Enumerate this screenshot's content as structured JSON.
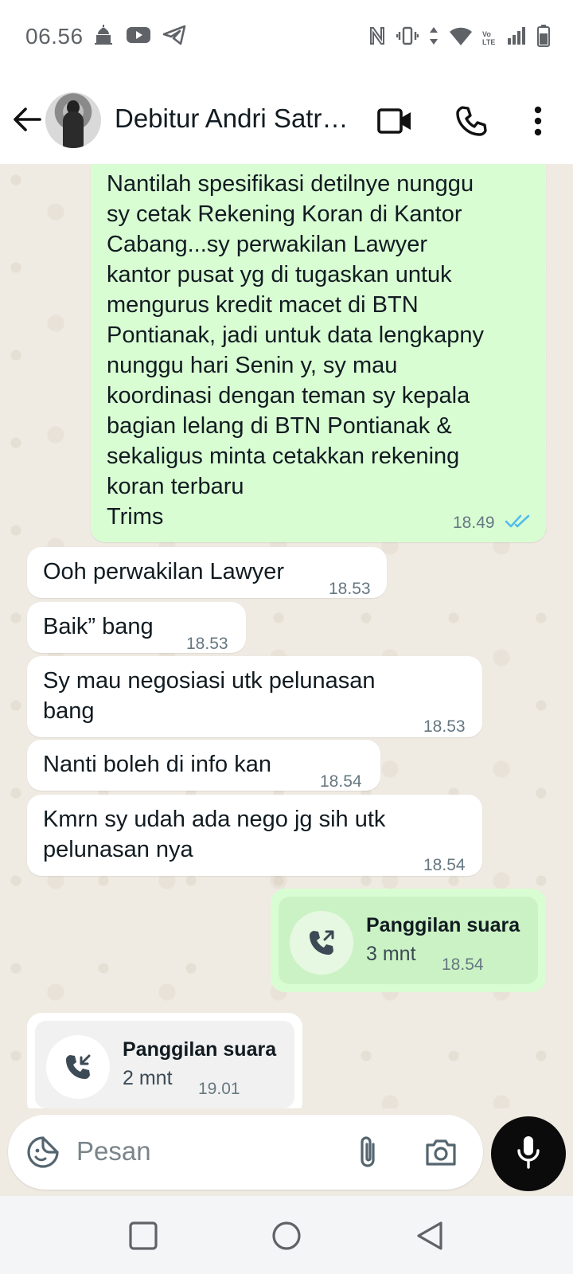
{
  "status_bar": {
    "time": "06.56",
    "left_icons": [
      "mosque-icon",
      "youtube-icon",
      "telegram-icon"
    ],
    "right_icons": [
      "nfc-icon",
      "vibrate-icon",
      "data-arrows-icon",
      "wifi-icon",
      "volte-icon",
      "signal-icon",
      "battery-icon"
    ],
    "volte_label": "Vo LTE"
  },
  "header": {
    "contact_name": "Debitur Andri Satri…",
    "icons": [
      "back-arrow-icon",
      "video-call-icon",
      "voice-call-icon",
      "more-vert-icon"
    ]
  },
  "messages": [
    {
      "direction": "out",
      "text": "Nantilah spesifikasi detilnye nunggu\nsy cetak Rekening Koran di Kantor\nCabang...sy perwakilan Lawyer\nkantor pusat yg di tugaskan untuk\nmengurus kredit macet di BTN\nPontianak, jadi untuk data lengkapny\nnunggu hari Senin y, sy mau\nkoordinasi dengan teman sy kepala\nbagian lelang di BTN Pontianak &\nsekaligus minta cetakkan rekening\nkoran terbaru\nTrims",
      "time": "18.49",
      "status": "read"
    },
    {
      "direction": "in",
      "text": "Ooh perwakilan Lawyer",
      "time": "18.53"
    },
    {
      "direction": "in",
      "text": "Baik” bang",
      "time": "18.53"
    },
    {
      "direction": "in",
      "text": "Sy mau negosiasi utk pelunasan\nbang",
      "time": "18.53"
    },
    {
      "direction": "in",
      "text": "Nanti boleh di info kan",
      "time": "18.54"
    },
    {
      "direction": "in",
      "text": "Kmrn sy udah ada nego jg sih utk\npelunasan nya",
      "time": "18.54"
    }
  ],
  "calls": [
    {
      "direction": "out",
      "title": "Panggilan suara",
      "duration": "3 mnt",
      "time": "18.54",
      "icon": "outgoing-call-icon"
    },
    {
      "direction": "in",
      "title": "Panggilan suara",
      "duration": "2 mnt",
      "time": "19.01",
      "icon": "incoming-call-icon"
    }
  ],
  "composer": {
    "placeholder": "Pesan",
    "icons": [
      "sticker-icon",
      "attach-icon",
      "camera-icon",
      "mic-icon"
    ]
  },
  "nav": {
    "buttons": [
      "recents-button",
      "home-button",
      "back-button"
    ]
  },
  "colors": {
    "outgoing_bubble": "#d9fdd3",
    "incoming_bubble": "#ffffff",
    "chat_background": "#efeae2",
    "read_tick": "#53bdeb",
    "mic_button": "#0b0b0b"
  }
}
